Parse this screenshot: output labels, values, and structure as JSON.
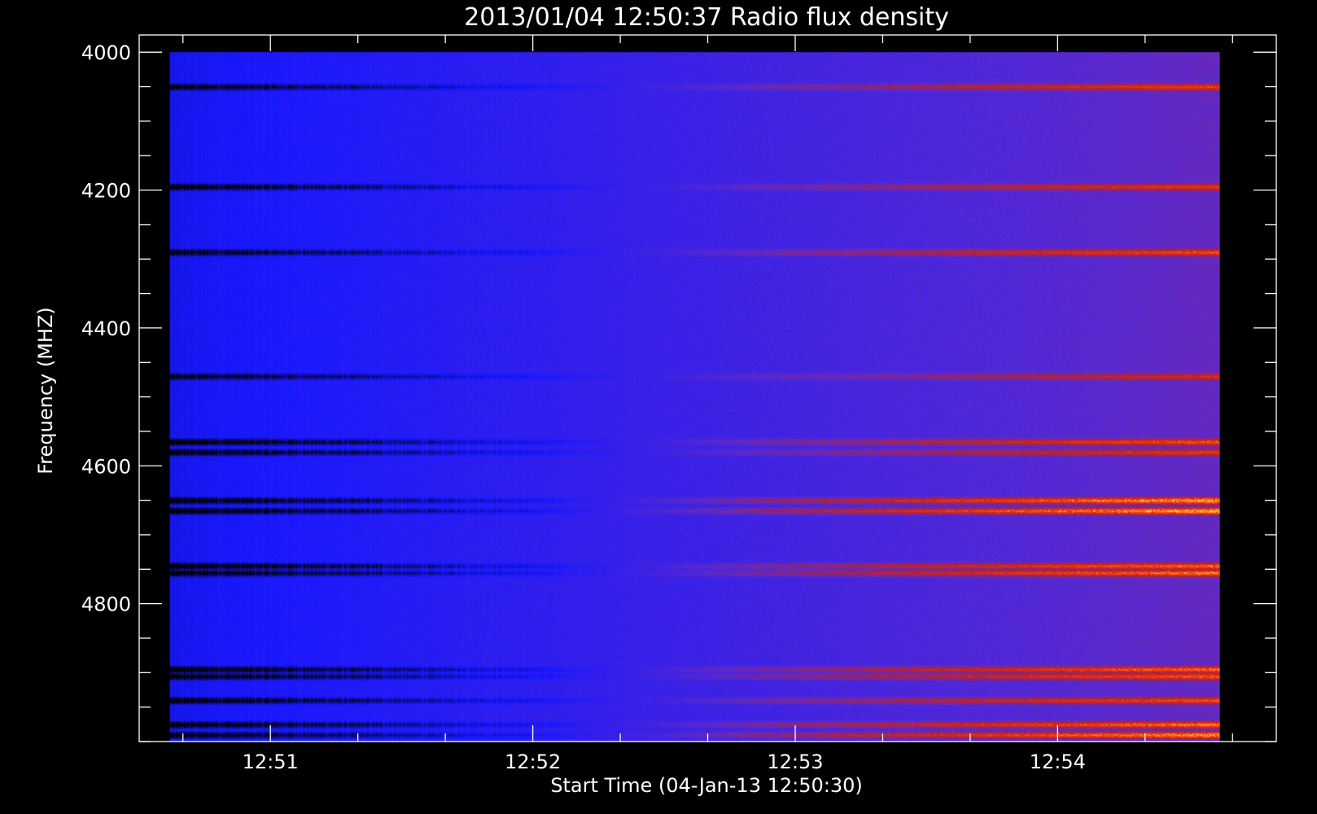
{
  "chart_data": {
    "type": "heatmap",
    "title": "2013/01/04 12:50:37 Radio flux density",
    "xlabel": "Start Time (04-Jan-13 12:50:30)",
    "ylabel": "Frequency (MHZ)",
    "x_range_seconds": [
      30,
      290
    ],
    "y_range_mhz": [
      3975,
      5000
    ],
    "data_x_seconds": [
      37,
      277
    ],
    "data_y_mhz": [
      4000,
      5000
    ],
    "x_ticks": [
      {
        "label": "12:51",
        "value": 60
      },
      {
        "label": "12:52",
        "value": 120
      },
      {
        "label": "12:53",
        "value": 180
      },
      {
        "label": "12:54",
        "value": 240
      }
    ],
    "x_minor_step_seconds": 20,
    "y_ticks": [
      {
        "label": "4000",
        "value": 4000
      },
      {
        "label": "4200",
        "value": 4200
      },
      {
        "label": "4400",
        "value": 4400
      },
      {
        "label": "4600",
        "value": 4600
      },
      {
        "label": "4800",
        "value": 4800
      }
    ],
    "y_minor_step_mhz": 50,
    "colormap": [
      "#000000",
      "#1818ff",
      "#5a2ad0",
      "#c02020",
      "#ff4010",
      "#ffd040"
    ],
    "background_color": "#000000",
    "bands_mhz": [
      {
        "freq": 4050,
        "early": 0.2,
        "late": 0.55
      },
      {
        "freq": 4195,
        "early": 0.15,
        "late": 0.5
      },
      {
        "freq": 4290,
        "early": 0.2,
        "late": 0.6
      },
      {
        "freq": 4470,
        "early": 0.25,
        "late": 0.4
      },
      {
        "freq": 4565,
        "early": 0.05,
        "late": 0.62
      },
      {
        "freq": 4580,
        "early": 0.1,
        "late": 0.5
      },
      {
        "freq": 4650,
        "early": 0.05,
        "late": 0.9
      },
      {
        "freq": 4665,
        "early": 0.05,
        "late": 0.95
      },
      {
        "freq": 4745,
        "early": 0.05,
        "late": 0.7
      },
      {
        "freq": 4755,
        "early": 0.1,
        "late": 0.75
      },
      {
        "freq": 4895,
        "early": 0.05,
        "late": 0.7
      },
      {
        "freq": 4905,
        "early": 0.1,
        "late": 0.65
      },
      {
        "freq": 4940,
        "early": 0.1,
        "late": 0.6
      },
      {
        "freq": 4975,
        "early": 0.1,
        "late": 0.75
      },
      {
        "freq": 4990,
        "early": 0.15,
        "late": 0.85
      }
    ]
  }
}
